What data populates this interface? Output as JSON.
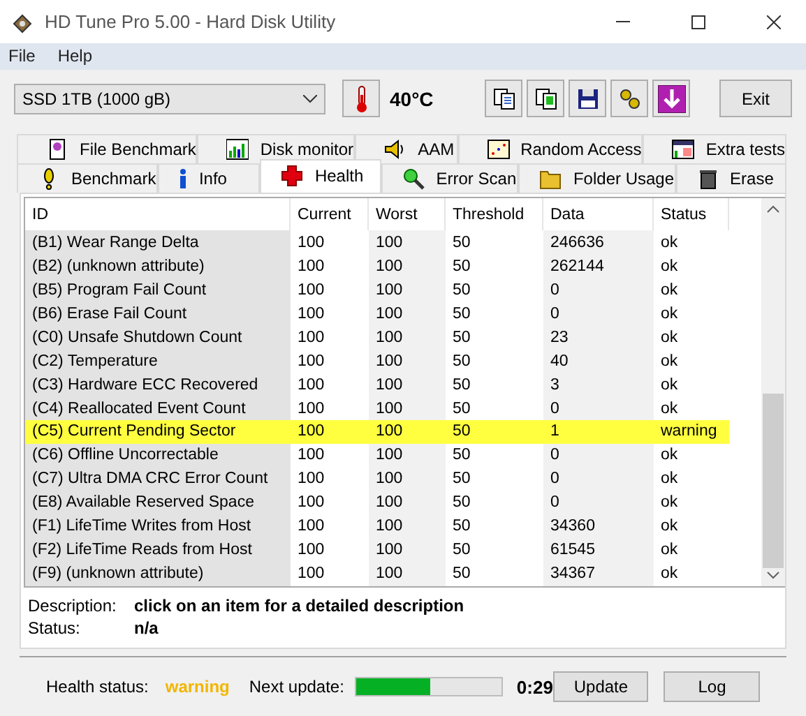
{
  "window": {
    "title": "HD Tune Pro 5.00 - Hard Disk Utility"
  },
  "menu": [
    {
      "label": "File"
    },
    {
      "label": "Help"
    }
  ],
  "toolbar": {
    "drive": "SSD 1TB (1000 gB)",
    "temperature": "40°C",
    "exit": "Exit"
  },
  "tab_rows": [
    [
      {
        "label": "File Benchmark",
        "selected": false
      },
      {
        "label": "Disk monitor",
        "selected": false
      },
      {
        "label": "AAM",
        "selected": false
      },
      {
        "label": "Random Access",
        "selected": false
      },
      {
        "label": "Extra tests",
        "selected": false
      }
    ],
    [
      {
        "label": "Benchmark",
        "selected": false
      },
      {
        "label": "Info",
        "selected": false
      },
      {
        "label": "Health",
        "selected": true
      },
      {
        "label": "Error Scan",
        "selected": false
      },
      {
        "label": "Folder Usage",
        "selected": false
      },
      {
        "label": "Erase",
        "selected": false
      }
    ]
  ],
  "table": {
    "columns": [
      "ID",
      "Current",
      "Worst",
      "Threshold",
      "Data",
      "Status"
    ],
    "rows": [
      {
        "cells": [
          "(B1) Wear Range Delta",
          "100",
          "100",
          "50",
          "246636",
          "ok"
        ],
        "alert": false
      },
      {
        "cells": [
          "(B2) (unknown attribute)",
          "100",
          "100",
          "50",
          "262144",
          "ok"
        ],
        "alert": false
      },
      {
        "cells": [
          "(B5) Program Fail Count",
          "100",
          "100",
          "50",
          "0",
          "ok"
        ],
        "alert": false
      },
      {
        "cells": [
          "(B6) Erase Fail Count",
          "100",
          "100",
          "50",
          "0",
          "ok"
        ],
        "alert": false
      },
      {
        "cells": [
          "(C0) Unsafe Shutdown Count",
          "100",
          "100",
          "50",
          "23",
          "ok"
        ],
        "alert": false
      },
      {
        "cells": [
          "(C2) Temperature",
          "100",
          "100",
          "50",
          "40",
          "ok"
        ],
        "alert": false
      },
      {
        "cells": [
          "(C3) Hardware ECC Recovered",
          "100",
          "100",
          "50",
          "3",
          "ok"
        ],
        "alert": false
      },
      {
        "cells": [
          "(C4) Reallocated Event Count",
          "100",
          "100",
          "50",
          "0",
          "ok"
        ],
        "alert": false
      },
      {
        "cells": [
          "(C5) Current Pending Sector",
          "100",
          "100",
          "50",
          "1",
          "warning"
        ],
        "alert": true
      },
      {
        "cells": [
          "(C6) Offline Uncorrectable",
          "100",
          "100",
          "50",
          "0",
          "ok"
        ],
        "alert": false
      },
      {
        "cells": [
          "(C7) Ultra DMA CRC Error Count",
          "100",
          "100",
          "50",
          "0",
          "ok"
        ],
        "alert": false
      },
      {
        "cells": [
          "(E8) Available Reserved Space",
          "100",
          "100",
          "50",
          "0",
          "ok"
        ],
        "alert": false
      },
      {
        "cells": [
          "(F1) LifeTime Writes from Host",
          "100",
          "100",
          "50",
          "34360",
          "ok"
        ],
        "alert": false
      },
      {
        "cells": [
          "(F2) LifeTime Reads from Host",
          "100",
          "100",
          "50",
          "61545",
          "ok"
        ],
        "alert": false
      },
      {
        "cells": [
          "(F9) (unknown attribute)",
          "100",
          "100",
          "50",
          "34367",
          "ok"
        ],
        "alert": false
      }
    ]
  },
  "details": [
    {
      "label": "Description:",
      "value": "click on an item for a detailed description"
    },
    {
      "label": "Status:",
      "value": "n/a"
    }
  ],
  "status_bar": {
    "health_label": "Health status:",
    "health_value": "warning",
    "alert": true,
    "next_label": "Next update:",
    "level": 0.51,
    "countdown": "0:29",
    "buttons": [
      "Update",
      "Log"
    ]
  }
}
